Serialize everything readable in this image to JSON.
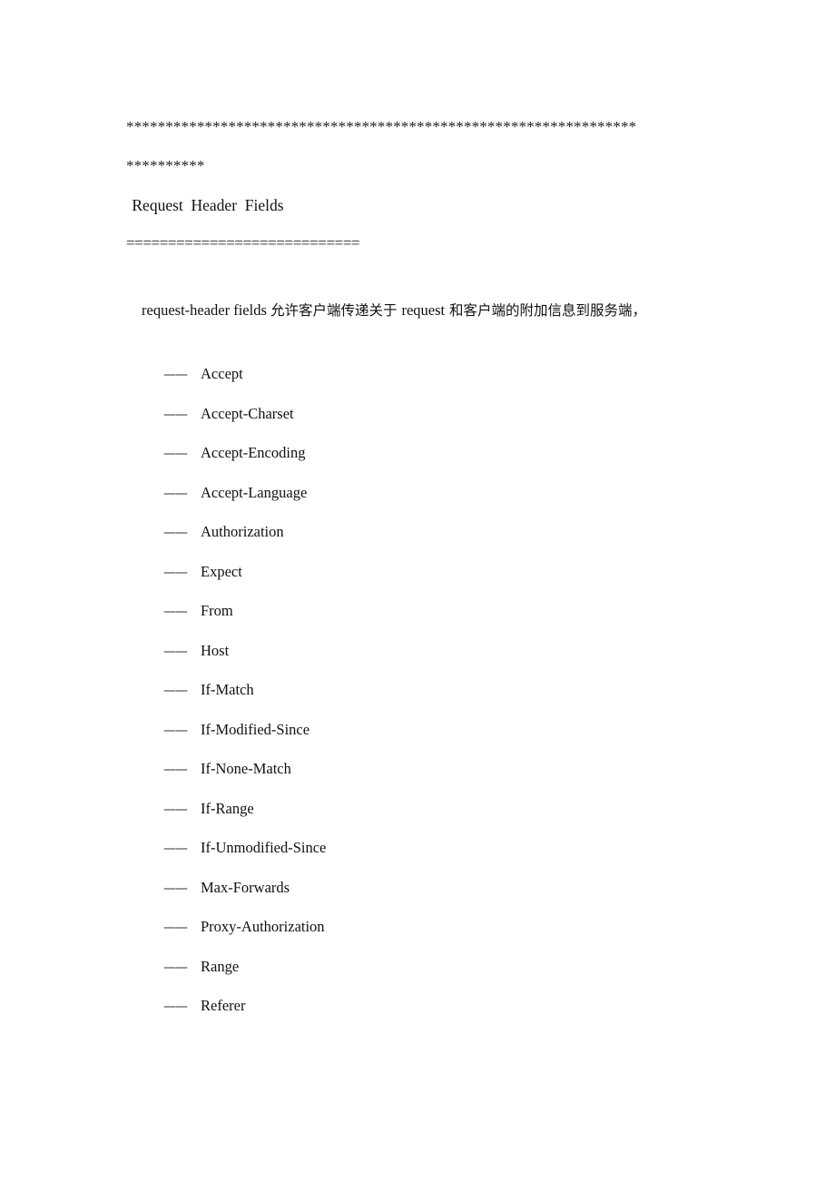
{
  "document": {
    "separators": {
      "asterisk_rule_1": "*****************************************************************",
      "asterisk_rule_2": "**********",
      "equals_rule": "============================"
    },
    "heading": " Request  Header  Fields",
    "intro_paragraph": {
      "full_text": "request-header  fields  允许客户端传递关于 request 和客户端的附加信息到服务端，",
      "latin_lead": "request-header  fields ",
      "cjk_part_1": " 允许客户端传递关于 ",
      "latin_mid": "request",
      "cjk_part_2": " 和客户端的附加信息到服务端，"
    },
    "field_bullet": "——",
    "fields": [
      {
        "name": "Accept"
      },
      {
        "name": "Accept-Charset"
      },
      {
        "name": "Accept-Encoding"
      },
      {
        "name": "Accept-Language"
      },
      {
        "name": "Authorization"
      },
      {
        "name": "Expect"
      },
      {
        "name": "From"
      },
      {
        "name": "Host"
      },
      {
        "name": "If-Match"
      },
      {
        "name": "If-Modified-Since"
      },
      {
        "name": "If-None-Match"
      },
      {
        "name": "If-Range"
      },
      {
        "name": "If-Unmodified-Since"
      },
      {
        "name": "Max-Forwards"
      },
      {
        "name": "Proxy-Authorization"
      },
      {
        "name": "Range"
      },
      {
        "name": "Referer"
      }
    ],
    "colors": {
      "page_background": "#ffffff",
      "text": "#111111",
      "rule": "#2b2b2b"
    }
  }
}
